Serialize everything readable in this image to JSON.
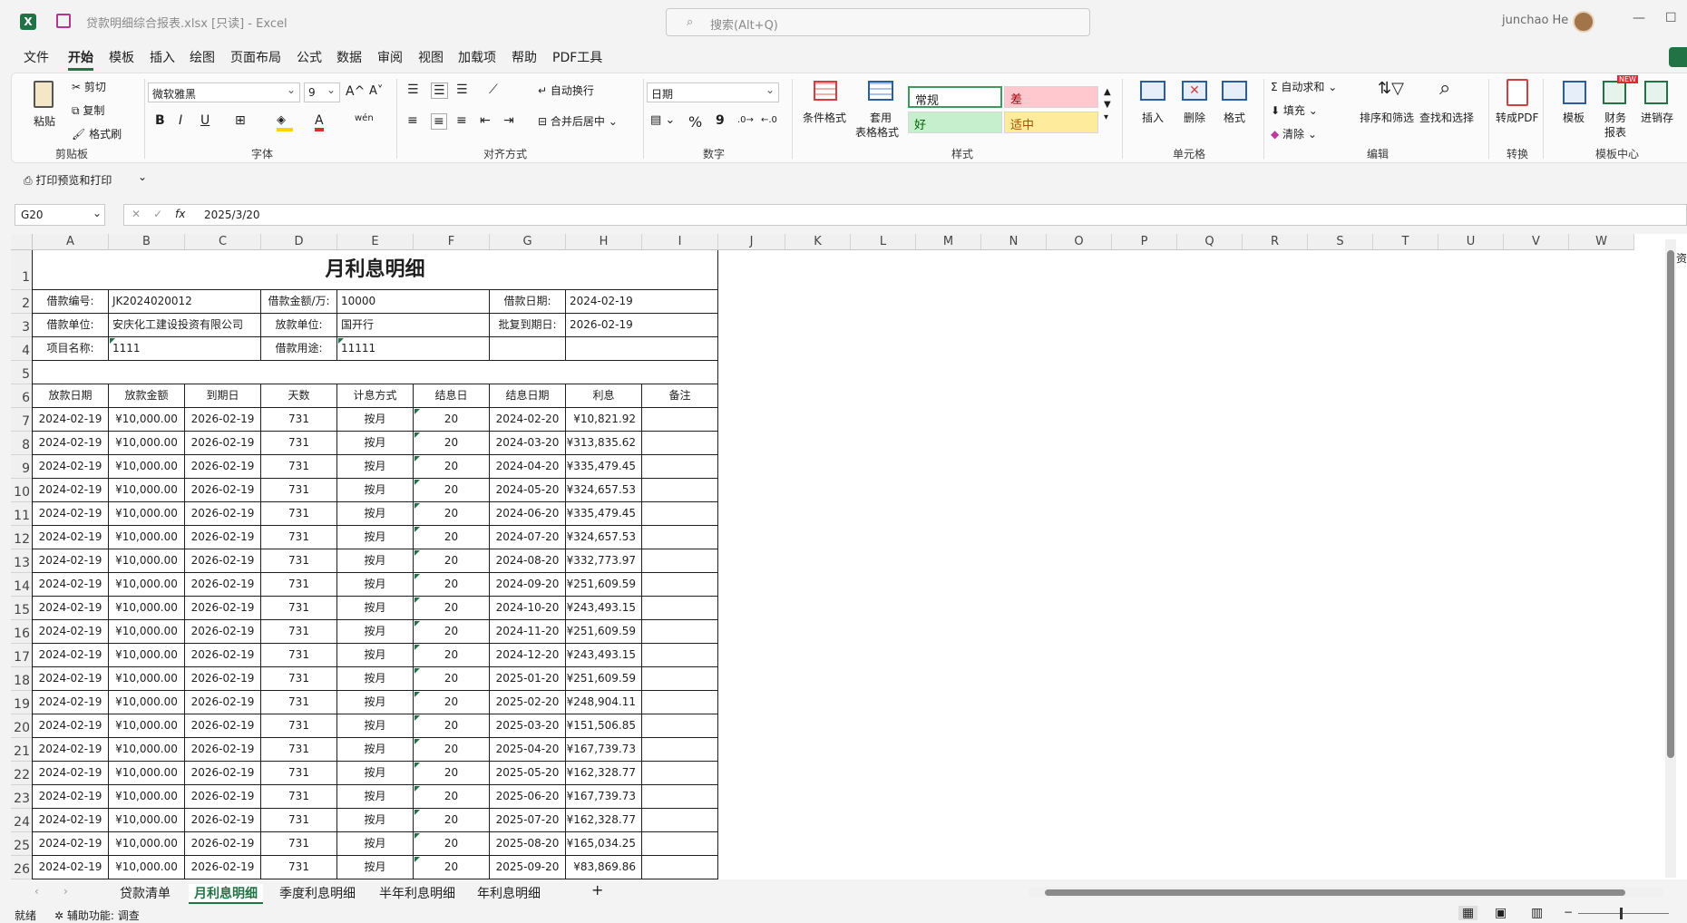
{
  "window": {
    "title": "贷款明细综合报表.xlsx  [只读]  -  Excel",
    "search_placeholder": "搜索(Alt+Q)",
    "user": "junchao He",
    "excel_icon": "X"
  },
  "menu": [
    "文件",
    "开始",
    "模板",
    "插入",
    "绘图",
    "页面布局",
    "公式",
    "数据",
    "审阅",
    "视图",
    "加载项",
    "帮助",
    "PDF工具"
  ],
  "ribbon": {
    "clipboard": {
      "paste": "粘贴",
      "cut": "剪切",
      "copy": "复制",
      "format_painter": "格式刷",
      "label": "剪贴板"
    },
    "font": {
      "name": "微软雅黑",
      "size": "9",
      "bold": "B",
      "italic": "I",
      "underline": "U",
      "label": "字体",
      "grow": "A^",
      "shrink": "A˅",
      "font_color": "A",
      "phonetic": "wén"
    },
    "alignment": {
      "wrap": "自动换行",
      "merge": "合并后居中",
      "label": "对齐方式"
    },
    "number": {
      "format": "日期",
      "percent": "%",
      "comma": "9",
      "label": "数字"
    },
    "styles": {
      "cond_format": "条件格式",
      "table_format_1": "套用",
      "table_format_2": "表格格式",
      "normal": "常规",
      "bad": "差",
      "good": "好",
      "neutral": "适中",
      "label": "样式"
    },
    "cells": {
      "insert": "插入",
      "delete": "删除",
      "format": "格式",
      "label": "单元格"
    },
    "editing": {
      "autosum": "自动求和",
      "fill": "填充",
      "clear": "清除",
      "sort": "排序和筛选",
      "find": "查找和选择",
      "label": "编辑"
    },
    "convert": {
      "pdf": "转成PDF",
      "label": "转换"
    },
    "templates": {
      "template": "模板",
      "finance_1": "财务",
      "finance_2": "报表",
      "invoice": "进销存",
      "new": "NEW",
      "label": "模板中心"
    }
  },
  "qat": {
    "print": "打印预览和打印"
  },
  "formula": {
    "cell_ref": "G20",
    "value": "2025/3/20",
    "fx": "fx"
  },
  "columns": [
    "A",
    "B",
    "C",
    "D",
    "E",
    "F",
    "G",
    "H",
    "I",
    "J",
    "K",
    "L",
    "M",
    "N",
    "O",
    "P",
    "Q",
    "R",
    "S",
    "T",
    "U",
    "V",
    "W"
  ],
  "sheet": {
    "title": "月利息明细",
    "info": [
      [
        "借款编号:",
        "JK2024020012",
        "借款金额/万:",
        "10000",
        "借款日期:",
        "2024-02-19"
      ],
      [
        "借款单位:",
        "安庆化工建设投资有限公司",
        "放款单位:",
        "国开行",
        "批复到期日:",
        "2026-02-19"
      ],
      [
        "项目名称:",
        "1111",
        "借款用途:",
        "11111",
        "",
        ""
      ]
    ],
    "headers": [
      "放款日期",
      "放款金额",
      "到期日",
      "天数",
      "计息方式",
      "结息日",
      "结息日期",
      "利息",
      "备注"
    ],
    "rows": [
      [
        "2024-02-19",
        "¥10,000.00",
        "2026-02-19",
        "731",
        "按月",
        "20",
        "2024-02-20",
        "¥10,821.92",
        ""
      ],
      [
        "2024-02-19",
        "¥10,000.00",
        "2026-02-19",
        "731",
        "按月",
        "20",
        "2024-03-20",
        "¥313,835.62",
        ""
      ],
      [
        "2024-02-19",
        "¥10,000.00",
        "2026-02-19",
        "731",
        "按月",
        "20",
        "2024-04-20",
        "¥335,479.45",
        ""
      ],
      [
        "2024-02-19",
        "¥10,000.00",
        "2026-02-19",
        "731",
        "按月",
        "20",
        "2024-05-20",
        "¥324,657.53",
        ""
      ],
      [
        "2024-02-19",
        "¥10,000.00",
        "2026-02-19",
        "731",
        "按月",
        "20",
        "2024-06-20",
        "¥335,479.45",
        ""
      ],
      [
        "2024-02-19",
        "¥10,000.00",
        "2026-02-19",
        "731",
        "按月",
        "20",
        "2024-07-20",
        "¥324,657.53",
        ""
      ],
      [
        "2024-02-19",
        "¥10,000.00",
        "2026-02-19",
        "731",
        "按月",
        "20",
        "2024-08-20",
        "¥332,773.97",
        ""
      ],
      [
        "2024-02-19",
        "¥10,000.00",
        "2026-02-19",
        "731",
        "按月",
        "20",
        "2024-09-20",
        "¥251,609.59",
        ""
      ],
      [
        "2024-02-19",
        "¥10,000.00",
        "2026-02-19",
        "731",
        "按月",
        "20",
        "2024-10-20",
        "¥243,493.15",
        ""
      ],
      [
        "2024-02-19",
        "¥10,000.00",
        "2026-02-19",
        "731",
        "按月",
        "20",
        "2024-11-20",
        "¥251,609.59",
        ""
      ],
      [
        "2024-02-19",
        "¥10,000.00",
        "2026-02-19",
        "731",
        "按月",
        "20",
        "2024-12-20",
        "¥243,493.15",
        ""
      ],
      [
        "2024-02-19",
        "¥10,000.00",
        "2026-02-19",
        "731",
        "按月",
        "20",
        "2025-01-20",
        "¥251,609.59",
        ""
      ],
      [
        "2024-02-19",
        "¥10,000.00",
        "2026-02-19",
        "731",
        "按月",
        "20",
        "2025-02-20",
        "¥248,904.11",
        ""
      ],
      [
        "2024-02-19",
        "¥10,000.00",
        "2026-02-19",
        "731",
        "按月",
        "20",
        "2025-03-20",
        "¥151,506.85",
        ""
      ],
      [
        "2024-02-19",
        "¥10,000.00",
        "2026-02-19",
        "731",
        "按月",
        "20",
        "2025-04-20",
        "¥167,739.73",
        ""
      ],
      [
        "2024-02-19",
        "¥10,000.00",
        "2026-02-19",
        "731",
        "按月",
        "20",
        "2025-05-20",
        "¥162,328.77",
        ""
      ],
      [
        "2024-02-19",
        "¥10,000.00",
        "2026-02-19",
        "731",
        "按月",
        "20",
        "2025-06-20",
        "¥167,739.73",
        ""
      ],
      [
        "2024-02-19",
        "¥10,000.00",
        "2026-02-19",
        "731",
        "按月",
        "20",
        "2025-07-20",
        "¥162,328.77",
        ""
      ],
      [
        "2024-02-19",
        "¥10,000.00",
        "2026-02-19",
        "731",
        "按月",
        "20",
        "2025-08-20",
        "¥165,034.25",
        ""
      ],
      [
        "2024-02-19",
        "¥10,000.00",
        "2026-02-19",
        "731",
        "按月",
        "20",
        "2025-09-20",
        "¥83,869.86",
        ""
      ]
    ]
  },
  "tabs": [
    "贷款清单",
    "月利息明细",
    "季度利息明细",
    "半年利息明细",
    "年利息明细"
  ],
  "add_sheet": "+",
  "status": {
    "ready": "就绪",
    "accessibility": "辅助功能: 调查"
  },
  "side_text": "资"
}
